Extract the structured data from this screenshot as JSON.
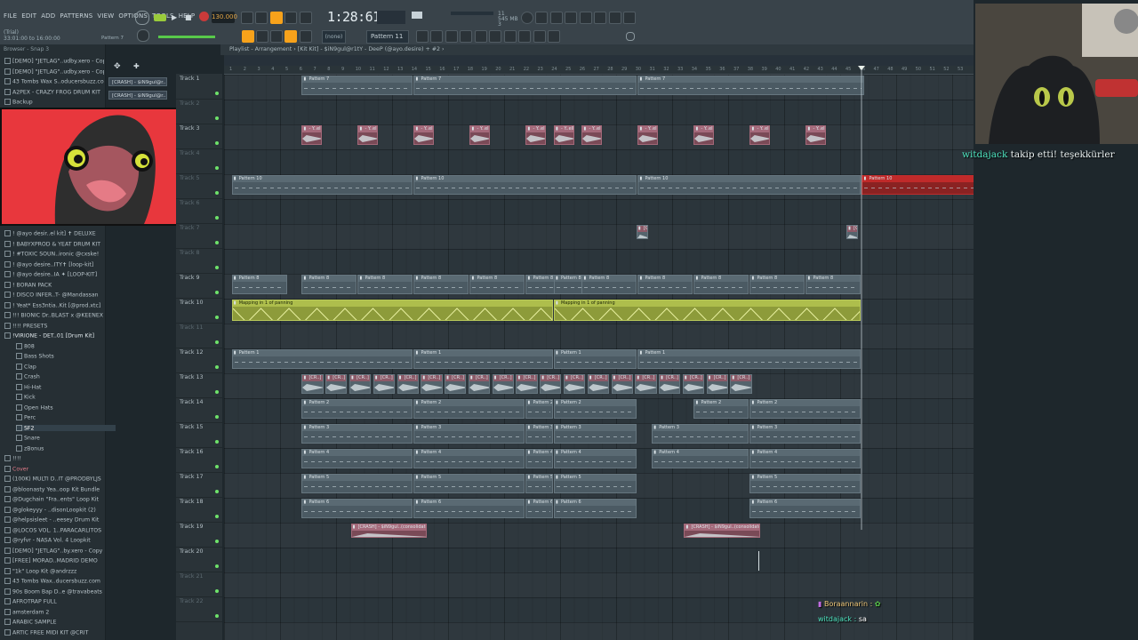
{
  "menu": [
    "FILE",
    "EDIT",
    "ADD",
    "PATTERNS",
    "VIEW",
    "OPTIONS",
    "TOOLS",
    "HELP"
  ],
  "transport": {
    "tempo": "130.000",
    "song_time": "1:28:61",
    "cpu_line1": "11",
    "cpu_line2": "545 MB",
    "cpu_line3": "3"
  },
  "hint": {
    "line1": "(Trial)",
    "line2": "33:01:00 to 16:00:00",
    "line3": "Pattern 7"
  },
  "toolbar": {
    "snap": "(none)",
    "pattern": "Pattern 11"
  },
  "browser": {
    "title": "Browser - Snap 3",
    "top_items": [
      "[DEMO] \"JETLAG\"..udby.xero - Copy",
      "[DEMO] \"JETLAG\"..udby.xero - Copy",
      "43 Tombs Wax S..oducersbuzz.com",
      "A2PEX - CRAZY FROG DRUM KIT",
      "Backup"
    ],
    "slots": [
      "[CRASH] - $iN9gul@r...",
      "[CRASH] - $iN9gul@r..."
    ],
    "items": [
      "! @ayo desir..el kit] ✝ DELUXE",
      "! BABYXPROD & YEAT DRUM KIT",
      "! #TOXIC SOUN..ironic @cxske!",
      "! @ayo desire..ITY✝ [loop-kit]",
      "! @ayo desire..IA ✦ [LOOP-KIT]",
      "! BORAN PACK",
      "! DISCO INFER..T- @Mandassan",
      "! Yeat* Ess3ntia..Kit [@prod.xtc]",
      "!!! BIONIC Dr..BLAST x @KEENEX",
      "!!!! PRESETS",
      "!VIRIONE - DET..01 [Drum Kit]"
    ],
    "subitems": [
      "808",
      "Bass Shots",
      "Clap",
      "Crash",
      "Hi-Hat",
      "Kick",
      "Open Hats",
      "Perc",
      "SF2",
      "Snare",
      "zBonus"
    ],
    "items2": [
      "!!!!",
      "Cover",
      "(100K) MULTI D..IT @PRODBYLJS",
      "@bloonasty Yea..oop Kit Bundle",
      "@Dugchain \"Fra..ents\" Loop Kit",
      "@glokeyyy - ..disonLoopkit (2)",
      "@helpsisleet - ..eesey Drum Kit",
      "@LOCOS VOL. 1..PARACARLITOS",
      "@ryfvr - NASA Vol. 4 Loopkit",
      "[DEMO] \"JETLAG\"..by.xero - Copy",
      "[FREE] MORAD..MADRID DEMO",
      "\"1k\" Loop Kit @andrzzz",
      "43 Tombs Wax..ducersbuzz.com",
      "90s Boom Bap D..e @travabeats",
      "AFROTRAP FULL",
      "amsterdam 2",
      "ARABIC SAMPLE",
      "ARTIC FREE MIDI KIT @CRIT"
    ]
  },
  "playlist": {
    "header": "Playlist - Arrangement › [Kit Kit] - $iN9gul@r1tY - DeeP (@ayo.desire) + #2 ›",
    "ruler": [
      "1",
      "2",
      "3",
      "4",
      "5",
      "6",
      "7",
      "8",
      "9",
      "10",
      "11",
      "12",
      "13",
      "14",
      "15",
      "16",
      "17",
      "18",
      "19",
      "20",
      "21",
      "22",
      "23",
      "24",
      "25",
      "26",
      "27",
      "28",
      "29",
      "30",
      "31",
      "32",
      "33",
      "34",
      "35",
      "36",
      "37",
      "38",
      "39",
      "40",
      "41",
      "42",
      "43",
      "44",
      "45",
      "46",
      "47",
      "48",
      "49",
      "50",
      "51",
      "52",
      "53"
    ],
    "tracks": [
      "Track 1",
      "Track 2",
      "Track 3",
      "Track 4",
      "Track 5",
      "Track 6",
      "Track 7",
      "Track 8",
      "Track 9",
      "Track 10",
      "Track 11",
      "Track 12",
      "Track 13",
      "Track 14",
      "Track 15",
      "Track 16",
      "Track 17",
      "Track 18",
      "Track 19",
      "Track 20",
      "Track 21",
      "Track 22"
    ],
    "clip_labels": {
      "p7": "Pattern 7",
      "p10": "Pattern 10",
      "p9": "Pattern 9",
      "p8": "Pattern 8",
      "p1": "Pattern 1",
      "p2": "Pattern 2",
      "p3": "Pattern 3",
      "p4": "Pattern 4",
      "p5": "Pattern 5",
      "p6": "Pattern 6",
      "auto": "Mapping in 1 of panning",
      "audio": "- Y..ell",
      "slice": "[CR..]",
      "crash": "[CRASH] - $iN9gul..(consolidated)"
    }
  },
  "overlay": {
    "follow_user": "witdajack",
    "follow_text": "takip etti! teşekkürler",
    "chat": [
      {
        "user": "Boraannarin :",
        "msg": ""
      },
      {
        "user": "witdajack :",
        "msg": "sa"
      }
    ]
  },
  "colors": {
    "accent": "#f7a21b",
    "follow_user": "#4fe6c1",
    "cam_bg": "#e8373d",
    "automation": "#aebe4c",
    "red_clip": "#c02a2a"
  }
}
